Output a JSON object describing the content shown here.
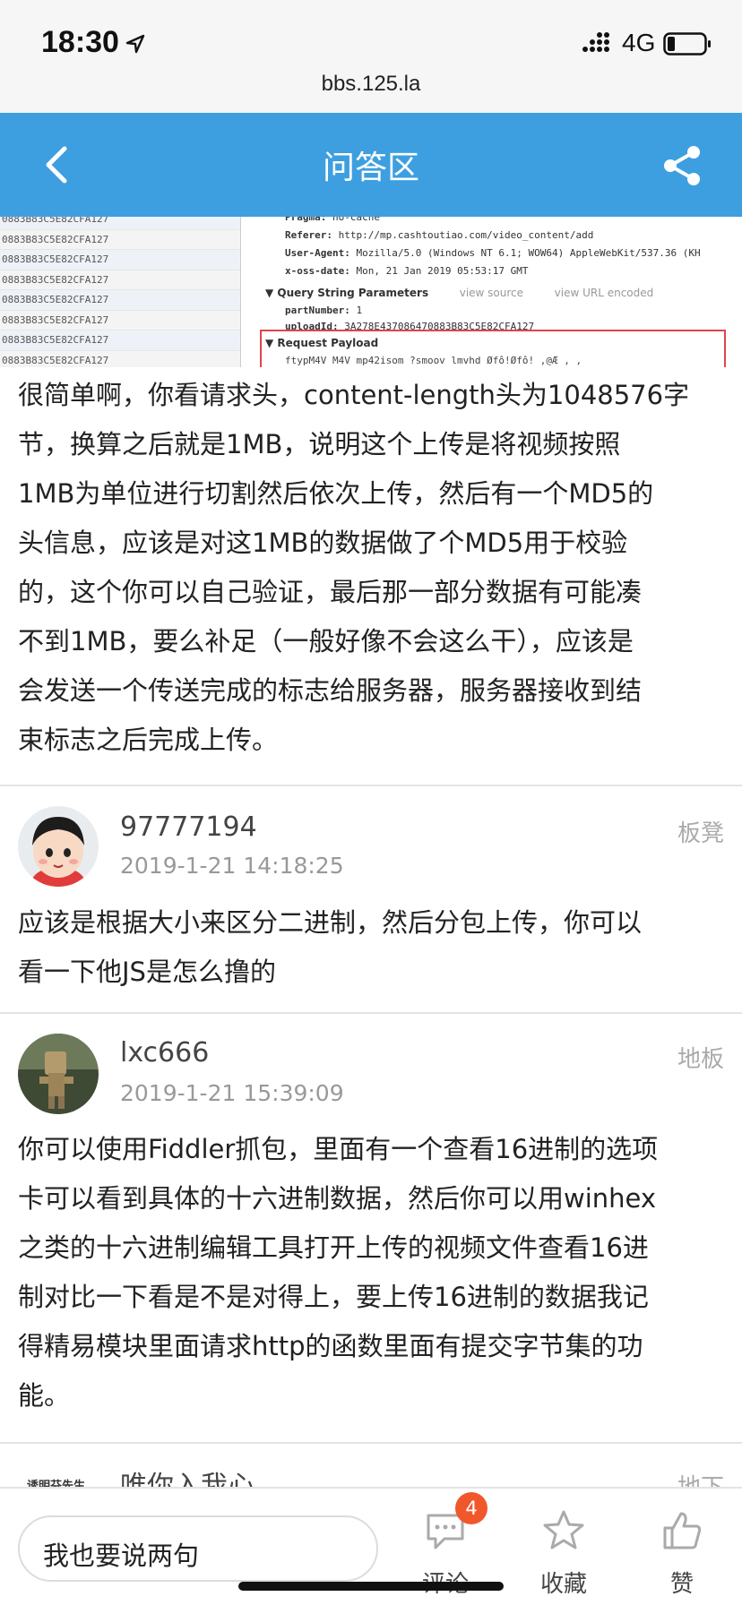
{
  "status_bar": {
    "time": "18:30",
    "network": "4G",
    "url": "bbs.125.la"
  },
  "nav": {
    "title": "问答区",
    "back_icon": "chevron-left-icon",
    "share_icon": "share-icon",
    "background": "#3d9fe0"
  },
  "screenshot_snippet": {
    "left_rows": [
      "0883B83C5E82CFA127",
      "0883B83C5E82CFA127",
      "0883B83C5E82CFA127",
      "0883B83C5E82CFA127",
      "0883B83C5E82CFA127",
      "0883B83C5E82CFA127",
      "0883B83C5E82CFA127",
      "0883B83C5E82CFA127"
    ],
    "headers": [
      {
        "key": "Pragma:",
        "value": "no-cache"
      },
      {
        "key": "Referer:",
        "value": "http://mp.cashtoutiao.com/video_content/add"
      },
      {
        "key": "User-Agent:",
        "value": "Mozilla/5.0 (Windows NT 6.1; WOW64) AppleWebKit/537.36 (KH"
      },
      {
        "key": "x-oss-date:",
        "value": "Mon, 21 Jan 2019 05:53:17 GMT"
      }
    ],
    "query_section": "▼ Query String Parameters",
    "view_source": "view source",
    "view_url_encoded": "view URL encoded",
    "params": [
      {
        "key": "partNumber:",
        "value": "1"
      },
      {
        "key": "uploadId:",
        "value": "3A278E437086470883B83C5E82CFA127"
      }
    ],
    "payload_section": "▼ Request Payload",
    "payload_preview": "  ftypM4V    M4V mp42isom  ?smoov   lmvhd    Øfô!Øfô!  ,@Æ  ,  ,"
  },
  "post": {
    "body_lines": [
      "很简单啊，你看请求头，content-length头为1048576字",
      "节，换算之后就是1MB，说明这个上传是将视频按照",
      "1MB为单位进行切割然后依次上传，然后有一个MD5的",
      "头信息，应该是对这1MB的数据做了个MD5用于校验",
      "的，这个你可以自己验证，最后那一部分数据有可能凑",
      "不到1MB，要么补足（一般好像不会这么干），应该是",
      "会发送一个传送完成的标志给服务器，服务器接收到结",
      "束标志之后完成上传。"
    ]
  },
  "comments": [
    {
      "username": "97777194",
      "time": "2019-1-21 14:18:25",
      "floor": "板凳",
      "body_lines": [
        "应该是根据大小来区分二进制，然后分包上传，你可以",
        "看一下他JS是怎么撸的"
      ]
    },
    {
      "username": "lxc666",
      "time": "2019-1-21 15:39:09",
      "floor": "地板",
      "body_lines": [
        "你可以使用Fiddler抓包，里面有一个查看16进制的选项",
        "卡可以看到具体的十六进制数据，然后你可以用winhex",
        "之类的十六进制编辑工具打开上传的视频文件查看16进",
        "制对比一下看是不是对得上，要上传16进制的数据我记",
        "得精易模块里面请求http的函数里面有提交字节集的功",
        "能。"
      ]
    },
    {
      "username": "唯你入我心",
      "avatar_text": "诱明芬先生",
      "floor": "地下"
    }
  ],
  "bottom_bar": {
    "reply_placeholder": "我也要说两句",
    "comment_label": "评论",
    "comment_count": "4",
    "favorite_label": "收藏",
    "like_label": "赞",
    "badge_color": "#f0582b"
  }
}
